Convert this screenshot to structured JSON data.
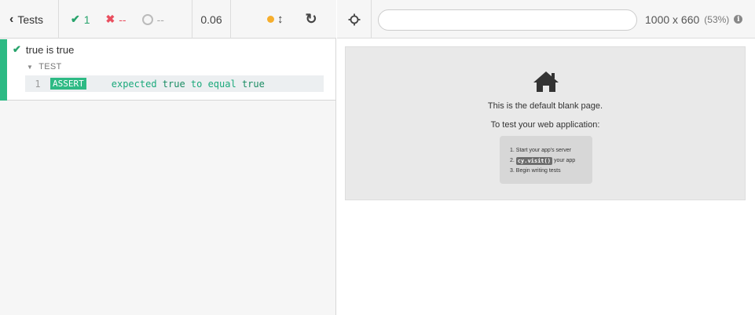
{
  "reporter": {
    "back_label": "Tests",
    "stats": {
      "passed": "1",
      "failed": "--",
      "pending": "--"
    },
    "duration": "0.06",
    "test": {
      "title": "true is true",
      "hook": "TEST",
      "command": {
        "number": "1",
        "name": "ASSERT",
        "parts": [
          "expected ",
          "true",
          " to equal ",
          "true"
        ]
      }
    }
  },
  "aut": {
    "url": "",
    "viewport": {
      "size": "1000 x 660",
      "scale": "(53%)",
      "info": "i"
    },
    "blank_page": {
      "line1": "This is the default blank page.",
      "line2": "To test your web application:",
      "steps": [
        {
          "num": "1.",
          "text": "Start your app's server"
        },
        {
          "num": "2.",
          "code": "cy.visit()",
          "text": "your app"
        },
        {
          "num": "3.",
          "text": "Begin writing tests"
        }
      ]
    }
  },
  "colors": {
    "pass": "#27a36b",
    "fail": "#e94f5f",
    "accent": "#2dba84",
    "running_dot": "#f6ae2d"
  },
  "icons": [
    "chevron-left-icon",
    "check-icon",
    "x-icon",
    "pending-ring-icon",
    "running-dot-icon",
    "resize-icon",
    "restart-icon",
    "crosshair-icon",
    "info-icon",
    "home-icon"
  ]
}
